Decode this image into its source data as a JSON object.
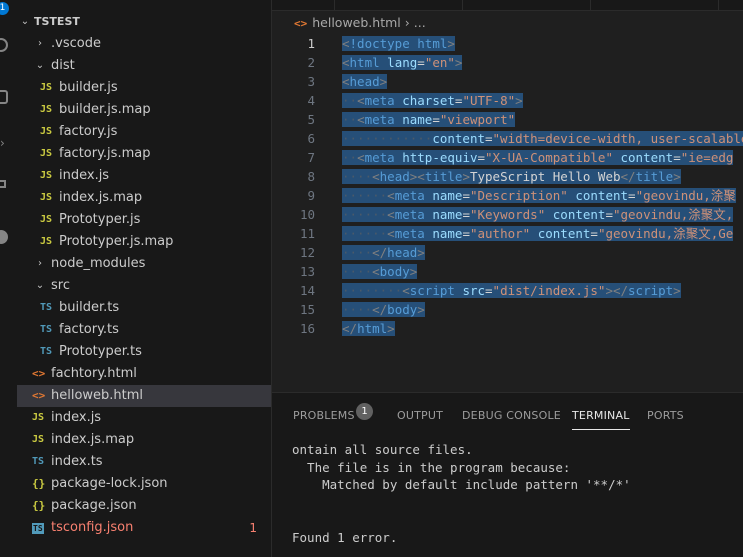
{
  "activity_bar": {
    "badge": "1"
  },
  "explorer": {
    "root": "TSTEST",
    "items": [
      {
        "label": ".vscode",
        "kind": "folder",
        "state": "collapsed",
        "depth": 1
      },
      {
        "label": "dist",
        "kind": "folder",
        "state": "expanded",
        "depth": 1
      },
      {
        "label": "builder.js",
        "kind": "js",
        "icon": "JS",
        "depth": 2
      },
      {
        "label": "builder.js.map",
        "kind": "js",
        "icon": "JS",
        "depth": 2
      },
      {
        "label": "factory.js",
        "kind": "js",
        "icon": "JS",
        "depth": 2
      },
      {
        "label": "factory.js.map",
        "kind": "js",
        "icon": "JS",
        "depth": 2
      },
      {
        "label": "index.js",
        "kind": "js",
        "icon": "JS",
        "depth": 2
      },
      {
        "label": "index.js.map",
        "kind": "js",
        "icon": "JS",
        "depth": 2
      },
      {
        "label": "Prototyper.js",
        "kind": "js",
        "icon": "JS",
        "depth": 2
      },
      {
        "label": "Prototyper.js.map",
        "kind": "js",
        "icon": "JS",
        "depth": 2
      },
      {
        "label": "node_modules",
        "kind": "folder",
        "state": "collapsed",
        "depth": 1
      },
      {
        "label": "src",
        "kind": "folder",
        "state": "expanded",
        "depth": 1
      },
      {
        "label": "builder.ts",
        "kind": "ts",
        "icon": "TS",
        "depth": 2
      },
      {
        "label": "factory.ts",
        "kind": "ts",
        "icon": "TS",
        "depth": 2
      },
      {
        "label": "Prototyper.ts",
        "kind": "ts",
        "icon": "TS",
        "depth": 2
      },
      {
        "label": "fachtory.html",
        "kind": "html",
        "icon": "<>",
        "depth": 1
      },
      {
        "label": "helloweb.html",
        "kind": "html",
        "icon": "<>",
        "depth": 1,
        "selected": true
      },
      {
        "label": "index.js",
        "kind": "js",
        "icon": "JS",
        "depth": 1
      },
      {
        "label": "index.js.map",
        "kind": "js",
        "icon": "JS",
        "depth": 1
      },
      {
        "label": "index.ts",
        "kind": "ts",
        "icon": "TS",
        "depth": 1
      },
      {
        "label": "package-lock.json",
        "kind": "json",
        "icon": "{}",
        "depth": 1
      },
      {
        "label": "package.json",
        "kind": "json",
        "icon": "{}",
        "depth": 1
      },
      {
        "label": "tsconfig.json",
        "kind": "tsconfig",
        "icon": "TS",
        "depth": 1,
        "error": true,
        "error_count": "1"
      }
    ]
  },
  "editor": {
    "breadcrumb": {
      "file": "helloweb.html",
      "more": "..."
    },
    "active_line": 1,
    "lines": [
      {
        "n": "1",
        "indent": 0,
        "tokens": [
          [
            "tp",
            "<"
          ],
          [
            "tg",
            "!doctype"
          ],
          [
            "tx",
            " "
          ],
          [
            "tg",
            "html"
          ],
          [
            "tp",
            ">"
          ]
        ]
      },
      {
        "n": "2",
        "indent": 0,
        "tokens": [
          [
            "tp",
            "<"
          ],
          [
            "tg",
            "html"
          ],
          [
            "tx",
            " "
          ],
          [
            "at",
            "lang"
          ],
          [
            "tx",
            "="
          ],
          [
            "sv",
            "\"en\""
          ],
          [
            "tp",
            ">"
          ]
        ]
      },
      {
        "n": "3",
        "indent": 0,
        "tokens": [
          [
            "tp",
            "<"
          ],
          [
            "tg",
            "head"
          ],
          [
            "tp",
            ">"
          ]
        ]
      },
      {
        "n": "4",
        "indent": 1,
        "tokens": [
          [
            "tp",
            "<"
          ],
          [
            "tg",
            "meta"
          ],
          [
            "tx",
            " "
          ],
          [
            "at",
            "charset"
          ],
          [
            "tx",
            "="
          ],
          [
            "sv",
            "\"UTF-8\""
          ],
          [
            "tp",
            ">"
          ]
        ]
      },
      {
        "n": "5",
        "indent": 1,
        "tokens": [
          [
            "tp",
            "<"
          ],
          [
            "tg",
            "meta"
          ],
          [
            "tx",
            " "
          ],
          [
            "at",
            "name"
          ],
          [
            "tx",
            "="
          ],
          [
            "sv",
            "\"viewport\""
          ]
        ]
      },
      {
        "n": "6",
        "indent": 6,
        "tokens": [
          [
            "at",
            "content"
          ],
          [
            "tx",
            "="
          ],
          [
            "sv",
            "\"width=device-width, user-scalable=no"
          ]
        ]
      },
      {
        "n": "7",
        "indent": 1,
        "tokens": [
          [
            "tp",
            "<"
          ],
          [
            "tg",
            "meta"
          ],
          [
            "tx",
            " "
          ],
          [
            "at",
            "http-equiv"
          ],
          [
            "tx",
            "="
          ],
          [
            "sv",
            "\"X-UA-Compatible\""
          ],
          [
            "tx",
            " "
          ],
          [
            "at",
            "content"
          ],
          [
            "tx",
            "="
          ],
          [
            "sv",
            "\"ie=edg"
          ]
        ]
      },
      {
        "n": "8",
        "indent": 2,
        "tokens": [
          [
            "tp",
            "<"
          ],
          [
            "tg",
            "head"
          ],
          [
            "tp",
            "><"
          ],
          [
            "tg",
            "title"
          ],
          [
            "tp",
            ">"
          ],
          [
            "tx",
            "TypeScript Hello Web"
          ],
          [
            "tp",
            "</"
          ],
          [
            "tg",
            "title"
          ],
          [
            "tp",
            ">"
          ]
        ]
      },
      {
        "n": "9",
        "indent": 3,
        "tokens": [
          [
            "tp",
            "<"
          ],
          [
            "tg",
            "meta"
          ],
          [
            "tx",
            " "
          ],
          [
            "at",
            "name"
          ],
          [
            "tx",
            "="
          ],
          [
            "sv",
            "\"Description\""
          ],
          [
            "tx",
            " "
          ],
          [
            "at",
            "content"
          ],
          [
            "tx",
            "="
          ],
          [
            "sv",
            "\"geovindu,涂聚"
          ]
        ]
      },
      {
        "n": "10",
        "indent": 3,
        "tokens": [
          [
            "tp",
            "<"
          ],
          [
            "tg",
            "meta"
          ],
          [
            "tx",
            " "
          ],
          [
            "at",
            "name"
          ],
          [
            "tx",
            "="
          ],
          [
            "sv",
            "\"Keywords\""
          ],
          [
            "tx",
            " "
          ],
          [
            "at",
            "content"
          ],
          [
            "tx",
            "="
          ],
          [
            "sv",
            "\"geovindu,涂聚文,"
          ]
        ]
      },
      {
        "n": "11",
        "indent": 3,
        "tokens": [
          [
            "tp",
            "<"
          ],
          [
            "tg",
            "meta"
          ],
          [
            "tx",
            " "
          ],
          [
            "at",
            "name"
          ],
          [
            "tx",
            "="
          ],
          [
            "sv",
            "\"author\""
          ],
          [
            "tx",
            " "
          ],
          [
            "at",
            "content"
          ],
          [
            "tx",
            "="
          ],
          [
            "sv",
            "\"geovindu,涂聚文,Ge"
          ]
        ]
      },
      {
        "n": "12",
        "indent": 2,
        "tokens": [
          [
            "tp",
            "</"
          ],
          [
            "tg",
            "head"
          ],
          [
            "tp",
            ">"
          ]
        ]
      },
      {
        "n": "13",
        "indent": 2,
        "tokens": [
          [
            "tp",
            "<"
          ],
          [
            "tg",
            "body"
          ],
          [
            "tp",
            ">"
          ]
        ]
      },
      {
        "n": "14",
        "indent": 4,
        "tokens": [
          [
            "tp",
            "<"
          ],
          [
            "tg",
            "script"
          ],
          [
            "tx",
            " "
          ],
          [
            "at",
            "src"
          ],
          [
            "tx",
            "="
          ],
          [
            "sv",
            "\"dist/index.js\""
          ],
          [
            "tp",
            "></"
          ],
          [
            "tg",
            "script"
          ],
          [
            "tp",
            ">"
          ]
        ]
      },
      {
        "n": "15",
        "indent": 2,
        "tokens": [
          [
            "tp",
            "</"
          ],
          [
            "tg",
            "body"
          ],
          [
            "tp",
            ">"
          ]
        ]
      },
      {
        "n": "16",
        "indent": 0,
        "tokens": [
          [
            "tp",
            "</"
          ],
          [
            "tg",
            "html"
          ],
          [
            "tp",
            ">"
          ]
        ]
      }
    ]
  },
  "panel": {
    "tabs": [
      {
        "label": "PROBLEMS",
        "badge": "1"
      },
      {
        "label": "OUTPUT"
      },
      {
        "label": "DEBUG CONSOLE"
      },
      {
        "label": "TERMINAL",
        "active": true
      },
      {
        "label": "PORTS"
      }
    ],
    "terminal_lines": [
      "ontain all source files.",
      "  The file is in the program because:",
      "    Matched by default include pattern '**/*'",
      "",
      "",
      "Found 1 error."
    ]
  },
  "colors": {
    "accent": "#0078d4",
    "tag": "#569cd6",
    "attribute": "#9cdcfe",
    "string": "#ce9178",
    "selection": "#264f78",
    "error": "#f88070"
  }
}
